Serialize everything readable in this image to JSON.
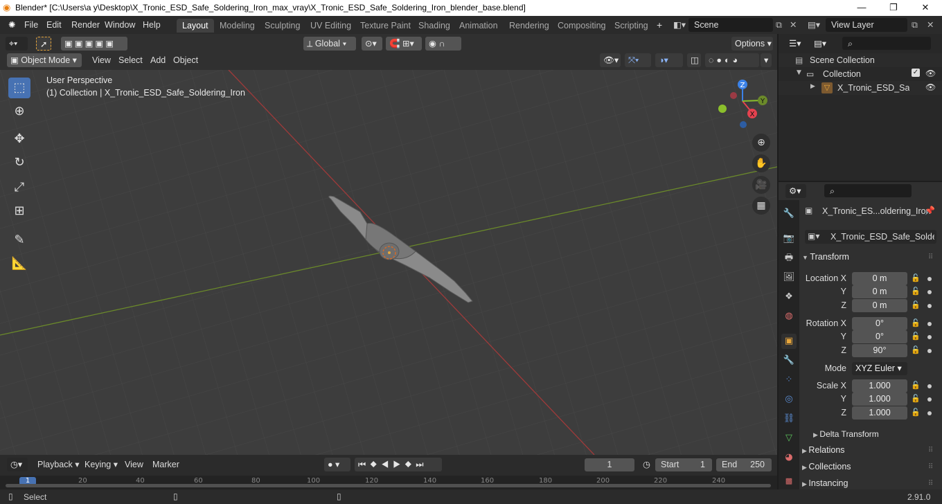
{
  "window": {
    "title": "Blender* [C:\\Users\\a y\\Desktop\\X_Tronic_ESD_Safe_Soldering_Iron_max_vray\\X_Tronic_ESD_Safe_Soldering_Iron_blender_base.blend]",
    "minimize": "—",
    "maximize": "❐",
    "close": "✕"
  },
  "menu": {
    "items": [
      "File",
      "Edit",
      "Render",
      "Window",
      "Help"
    ]
  },
  "workspaces": {
    "tabs": [
      "Layout",
      "Modeling",
      "Sculpting",
      "UV Editing",
      "Texture Paint",
      "Shading",
      "Animation",
      "Rendering",
      "Compositing",
      "Scripting"
    ],
    "active": "Layout",
    "add": "+"
  },
  "scene": {
    "name": "Scene",
    "view_layer": "View Layer"
  },
  "viewport_header": {
    "transform_orientation": "Global",
    "options": "Options",
    "mode": "Object Mode",
    "menus": [
      "View",
      "Select",
      "Add",
      "Object"
    ]
  },
  "viewport": {
    "perspective": "User Perspective",
    "collection_info": "(1) Collection | X_Tronic_ESD_Safe_Soldering_Iron",
    "gizmo": {
      "x": "X",
      "y": "Y",
      "z": "Z"
    }
  },
  "outliner": {
    "scene_collection": "Scene Collection",
    "collection": "Collection",
    "object": "X_Tronic_ESD_Safe_S"
  },
  "properties": {
    "object_name": "X_Tronic_ES...oldering_Iron",
    "data_name": "X_Tronic_ESD_Safe_Solderin...",
    "transform_title": "Transform",
    "location": {
      "label": "Location X",
      "x": "0 m",
      "y": "0 m",
      "z": "0 m"
    },
    "rotation": {
      "label": "Rotation X",
      "x": "0°",
      "y": "0°",
      "z": "90°"
    },
    "mode_label": "Mode",
    "mode_value": "XYZ Euler",
    "scale": {
      "label": "Scale X",
      "x": "1.000",
      "y": "1.000",
      "z": "1.000"
    },
    "axis_y": "Y",
    "axis_z": "Z",
    "delta": "Delta Transform",
    "relations": "Relations",
    "collections": "Collections",
    "instancing": "Instancing"
  },
  "timeline": {
    "menus": [
      "Playback",
      "Keying",
      "View",
      "Marker"
    ],
    "current_frame": "1",
    "start_label": "Start",
    "start": "1",
    "end_label": "End",
    "end": "250",
    "ruler": [
      "20",
      "40",
      "60",
      "80",
      "100",
      "120",
      "140",
      "160",
      "180",
      "200",
      "220",
      "240"
    ],
    "playhead": "1"
  },
  "status": {
    "action": "Select",
    "version": "2.91.0"
  },
  "colors": {
    "accent": "#4772b3",
    "x_axis": "#a03a3a",
    "y_axis": "#6b8a2a",
    "gizmo_x": "#e6424f",
    "gizmo_y": "#8bbf2c",
    "gizmo_z": "#3b82e8"
  }
}
